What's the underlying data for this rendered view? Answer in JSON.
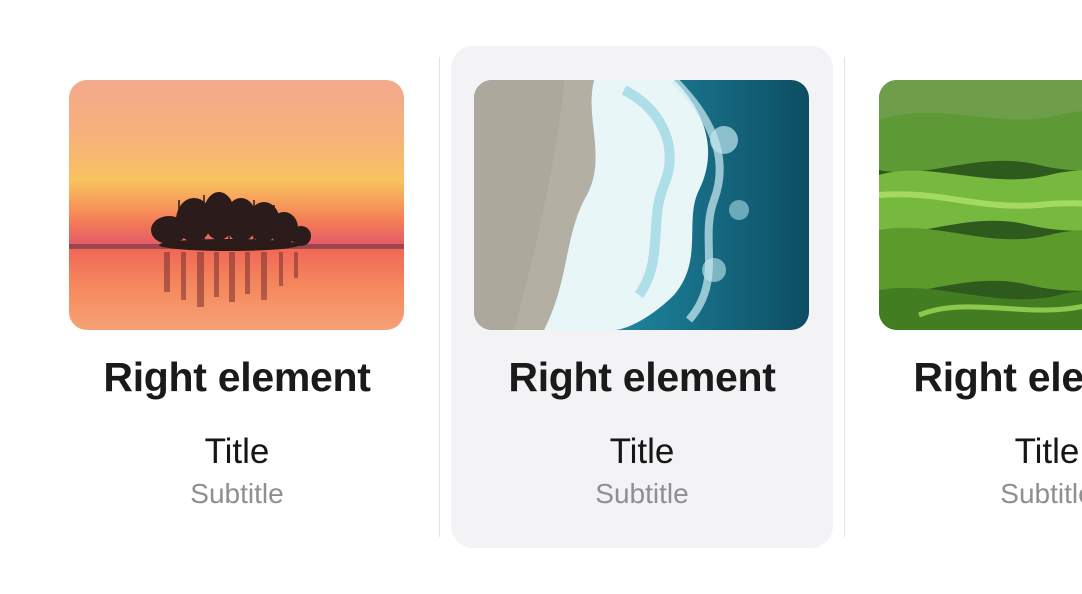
{
  "cards": [
    {
      "image_icon": "sunset-lake-island-image",
      "right_element": "Right element",
      "title": "Title",
      "subtitle": "Subtitle",
      "selected": false
    },
    {
      "image_icon": "ocean-wave-beach-image",
      "right_element": "Right element",
      "title": "Title",
      "subtitle": "Subtitle",
      "selected": true
    },
    {
      "image_icon": "green-hills-image",
      "right_element": "Right element",
      "title": "Title",
      "subtitle": "Subtitle",
      "selected": false
    }
  ],
  "colors": {
    "selected_background": "#f3f3f5",
    "subtitle": "#8e8e93",
    "text": "#1a1a1a",
    "divider": "#e3e3e6"
  }
}
